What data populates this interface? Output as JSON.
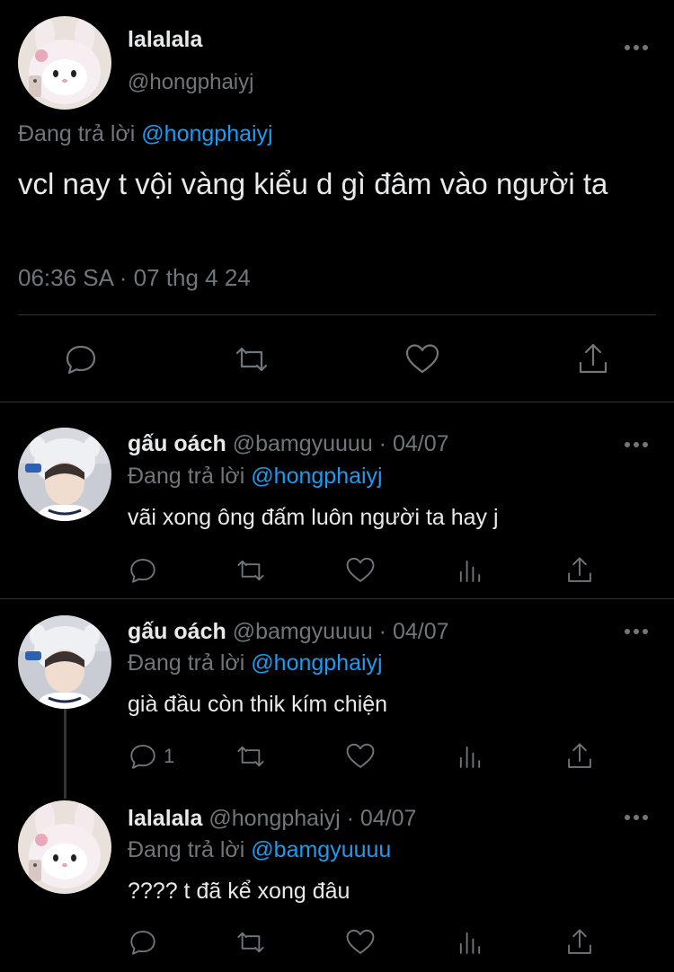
{
  "main_tweet": {
    "display_name": "lalalala",
    "handle": "@hongphaiyj",
    "replying_prefix": "Đang trả lời",
    "replying_to": "@hongphaiyj",
    "text": "vcl nay t vội vàng kiểu d gì đâm vào người ta",
    "timestamp": "06:36 SA · 07 thg 4 24",
    "avatar_icon": "melody-bunny-avatar"
  },
  "replies": [
    {
      "display_name": "gấu oách",
      "meta": "@bamgyuuuu · 04/07",
      "replying_prefix": "Đang trả lời",
      "replying_to": "@hongphaiyj",
      "text": "vãi xong ông đấm luôn người ta hay j",
      "reply_count": "",
      "avatar_icon": "person-hat-avatar"
    },
    {
      "display_name": "gấu oách",
      "meta": "@bamgyuuuu · 04/07",
      "replying_prefix": "Đang trả lời",
      "replying_to": "@hongphaiyj",
      "text": "già đầu còn thik kím chiện",
      "reply_count": "1",
      "avatar_icon": "person-hat-avatar"
    },
    {
      "display_name": "lalalala",
      "meta": "@hongphaiyj · 04/07",
      "replying_prefix": "Đang trả lời",
      "replying_to": "@bamgyuuuu",
      "text": "???? t đã kể xong đâu",
      "reply_count": "",
      "avatar_icon": "melody-bunny-avatar"
    }
  ],
  "colors": {
    "background": "#000000",
    "text_primary": "#e7e9ea",
    "text_secondary": "#71767b",
    "mention": "#1d9bf0",
    "divider": "#2f3336"
  }
}
